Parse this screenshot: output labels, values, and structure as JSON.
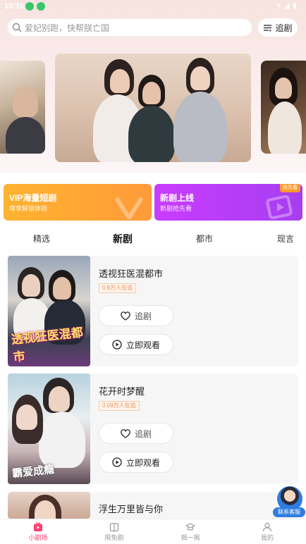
{
  "status_bar": {
    "time": "10:10",
    "icons": [
      "wifi-icon",
      "signal-icon",
      "battery-icon"
    ]
  },
  "search": {
    "placeholder": "爱妃别跑，快帮朕亡国"
  },
  "header": {
    "follow_label": "追剧"
  },
  "promos": [
    {
      "title": "VIP海量短剧",
      "subtitle": "尊享解锁体验",
      "color": "#ffa735"
    },
    {
      "title": "新剧上线",
      "subtitle": "新剧抢先看",
      "badge": "抢先看",
      "color": "#b83cf8"
    }
  ],
  "tabs": [
    {
      "label": "精选",
      "active": false
    },
    {
      "label": "新剧",
      "active": true
    },
    {
      "label": "都市",
      "active": false
    },
    {
      "label": "现言",
      "active": false
    }
  ],
  "dramas": [
    {
      "title": "透视狂医混都市",
      "watching": "0.9万人在追",
      "poster_title": "透视狂医混都市",
      "follow_label": "追剧",
      "play_label": "立即观看"
    },
    {
      "title": "花开时梦醒",
      "watching": "0.09万人在追",
      "poster_title": "霸爱成瘾",
      "follow_label": "追剧",
      "play_label": "立即观看"
    },
    {
      "title": "浮生万里皆与你"
    }
  ],
  "customer_service": {
    "label": "联系客服"
  },
  "bottom_nav": [
    {
      "label": "小剧场",
      "icon": "theater-icon",
      "active": true
    },
    {
      "label": "限免剧",
      "icon": "free-drama-icon",
      "active": false
    },
    {
      "label": "揭一揭",
      "icon": "discover-icon",
      "active": false
    },
    {
      "label": "我的",
      "icon": "user-icon",
      "active": false
    }
  ],
  "colors": {
    "accent": "#ff3d6e",
    "vip": "#ffa735",
    "new": "#b83cf8",
    "tag_text": "#f08a4b"
  }
}
